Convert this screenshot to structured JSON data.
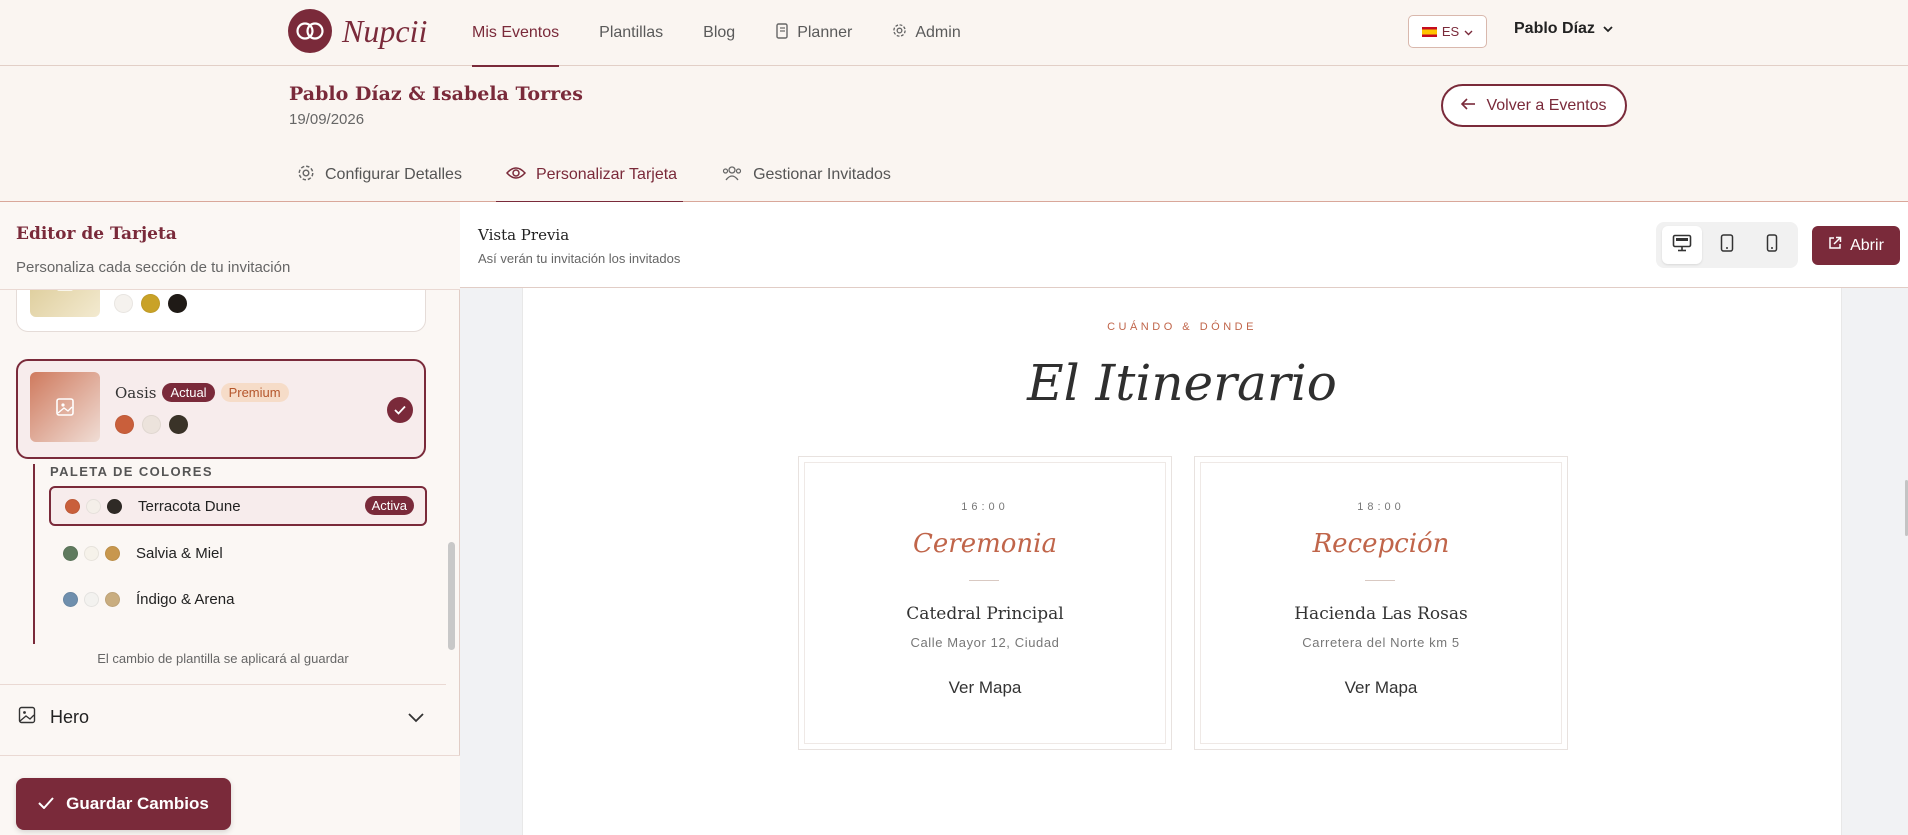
{
  "brand": {
    "name": "Nupcii"
  },
  "nav": {
    "links": [
      {
        "label": "Mis Eventos",
        "icon": ""
      },
      {
        "label": "Plantillas",
        "icon": ""
      },
      {
        "label": "Blog",
        "icon": ""
      },
      {
        "label": "Planner",
        "icon": "notebook-icon"
      },
      {
        "label": "Admin",
        "icon": "gear-icon"
      }
    ],
    "language": "ES",
    "user": "Pablo Díaz"
  },
  "event": {
    "title": "Pablo Díaz & Isabela Torres",
    "date": "19/09/2026",
    "back_label": "Volver a Eventos",
    "tabs": [
      {
        "label": "Configurar Detalles",
        "icon": "gear-icon"
      },
      {
        "label": "Personalizar Tarjeta",
        "icon": "eye-icon"
      },
      {
        "label": "Gestionar Invitados",
        "icon": "users-icon"
      }
    ]
  },
  "editor": {
    "title": "Editor de Tarjeta",
    "subtitle": "Personaliza cada sección de tu invitación",
    "template_prev": {
      "colors": [
        "#f5f2ee",
        "#c9a227",
        "#1f1a16"
      ]
    },
    "template_current": {
      "name": "Oasis",
      "badge_current": "Actual",
      "badge_premium": "Premium",
      "colors": [
        "#c95f3b",
        "#ece3dc",
        "#3a3328"
      ]
    },
    "palette": {
      "title": "PALETA DE COLORES",
      "items": [
        {
          "label": "Terracota Dune",
          "colors": [
            "#c95f3b",
            "#f4efe9",
            "#2f2a26"
          ],
          "active_label": "Activa"
        },
        {
          "label": "Salvia & Miel",
          "colors": [
            "#5f7a5e",
            "#f6f2ea",
            "#c8974d"
          ]
        },
        {
          "label": "Índigo & Arena",
          "colors": [
            "#6f8fad",
            "#f3f2ef",
            "#c9ad7f"
          ]
        }
      ]
    },
    "note": "El cambio de plantilla se aplicará al guardar",
    "section": "Hero",
    "save_label": "Guardar Cambios"
  },
  "preview": {
    "title": "Vista Previa",
    "subtitle": "Así verán tu invitación los invitados",
    "open_label": "Abrir",
    "kicker": "CUÁNDO & DÓNDE",
    "heading": "El Itinerario",
    "events": [
      {
        "time": "16:00",
        "name": "Ceremonia",
        "place": "Catedral Principal",
        "address": "Calle Mayor 12, Ciudad",
        "map_label": "Ver Mapa"
      },
      {
        "time": "18:00",
        "name": "Recepción",
        "place": "Hacienda Las Rosas",
        "address": "Carretera del Norte km 5",
        "map_label": "Ver Mapa"
      }
    ]
  }
}
